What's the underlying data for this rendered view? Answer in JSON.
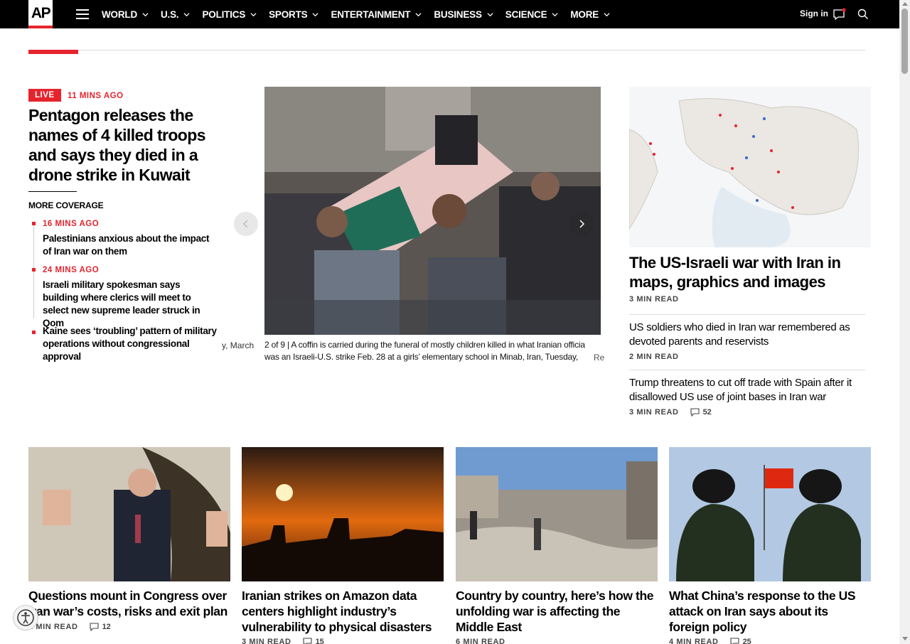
{
  "header": {
    "logo_text": "AP",
    "nav_items": [
      "WORLD",
      "U.S.",
      "POLITICS",
      "SPORTS",
      "ENTERTAINMENT",
      "BUSINESS",
      "SCIENCE",
      "MORE"
    ],
    "signin": "Sign in"
  },
  "lead": {
    "live_label": "LIVE",
    "time": "11 MINS AGO",
    "title": "Pentagon releases the names of 4 killed troops and says they died in a drone strike in Kuwait",
    "more_coverage": "MORE COVERAGE",
    "coverage": [
      {
        "time": "16 MINS AGO",
        "title": "Palestinians anxious about the impact of Iran war on them"
      },
      {
        "time": "24 MINS AGO",
        "title": "Israeli military spokesman says building where clerics will meet to select new supreme leader struck in Qom"
      },
      {
        "time": "",
        "title": "Kaine sees ‘troubling’ pattern of military operations without congressional approval"
      }
    ]
  },
  "carousel": {
    "caption_ghost": "y, March",
    "caption": "2 of 9 |  A coffin is carried during the funeral of mostly children killed in what Iranian officia was an Israeli-U.S. strike Feb. 28 at a girls’ elementary school in Minab, Iran, Tuesday,",
    "caption_fade": "Re"
  },
  "right": {
    "title": "The US-Israeli war with Iran in maps, graphics and images",
    "meta": "3 MIN READ",
    "stories": [
      {
        "title": "US soldiers who died in Iran war remembered as devoted parents and reservists",
        "meta": "2 MIN READ",
        "comments": ""
      },
      {
        "title": "Trump threatens to cut off trade with Spain after it disallowed US use of joint bases in Iran war",
        "meta": "3 MIN READ",
        "comments": "52"
      }
    ]
  },
  "cards": [
    {
      "title": "Questions mount in Congress over Iran war’s costs, risks and exit plan",
      "meta": "2 MIN READ",
      "comments": "12"
    },
    {
      "title": "Iranian strikes on Amazon data centers highlight industry’s vulnerability to physical disasters",
      "meta": "3 MIN READ",
      "comments": "15"
    },
    {
      "title": "Country by country, here’s how the unfolding war is affecting the Middle East",
      "meta": "6 MIN READ",
      "comments": ""
    },
    {
      "title": "What China’s response to the US attack on Iran says about its foreign policy",
      "meta": "4 MIN READ",
      "comments": "25"
    }
  ],
  "colors": {
    "accent": "#e6242d",
    "nav_bg": "#000000"
  }
}
